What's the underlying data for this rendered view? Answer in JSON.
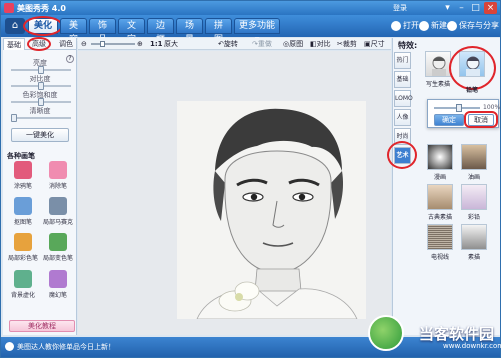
{
  "app": {
    "title": "美图秀秀 4.0",
    "login": "登录"
  },
  "menubar": {
    "tabs": [
      {
        "label": "美化",
        "active": true
      },
      {
        "label": "美容"
      },
      {
        "label": "饰品"
      },
      {
        "label": "文字"
      },
      {
        "label": "边框"
      },
      {
        "label": "场景"
      },
      {
        "label": "拼图"
      },
      {
        "label": "更多功能"
      }
    ],
    "open_label": "打开",
    "new_label": "新建",
    "save_label": "保存与分享"
  },
  "left_panel": {
    "subtabs": [
      "基础",
      "高级",
      "调色"
    ],
    "sliders": [
      {
        "label": "亮度",
        "value": 0.5
      },
      {
        "label": "对比度",
        "value": 0.5
      },
      {
        "label": "色彩饱和度",
        "value": 0.5
      },
      {
        "label": "清晰度",
        "value": 0.0
      }
    ],
    "auto_button": "一键美化",
    "brush_section": "各种画笔",
    "brushes": [
      {
        "label": "涂鸦笔",
        "color": "#e25b7c"
      },
      {
        "label": "消除笔",
        "color": "#f08cb0"
      },
      {
        "label": "抠图笔",
        "color": "#6a9ed8"
      },
      {
        "label": "局部马赛克",
        "color": "#7a8fa8"
      },
      {
        "label": "局部彩色笔",
        "color": "#e7a23d"
      },
      {
        "label": "局部变色笔",
        "color": "#59a85a"
      },
      {
        "label": "背景虚化",
        "color": "#5fb08d"
      },
      {
        "label": "魔幻笔",
        "color": "#b07ad0"
      }
    ],
    "beauty_button": "美化教程"
  },
  "toolbar": {
    "zoom_label": "1:1",
    "enlarge_label": "原大",
    "rotate_label": "旋转",
    "redo_label": "重做",
    "original_label": "原图",
    "compare_label": "对比",
    "crop_label": "裁剪",
    "size_label": "尺寸"
  },
  "right_panel": {
    "title": "特效:",
    "categories": [
      "热门",
      "基础",
      "LOMO",
      "人像",
      "时尚",
      "艺术"
    ],
    "active_category": "艺术",
    "popup": {
      "value": "100%",
      "confirm_label": "确定",
      "cancel_label": "取消",
      "level": 1.0
    },
    "effects": [
      {
        "label": "写生素描"
      },
      {
        "label": "铅笔"
      },
      {
        "label": "漫画"
      },
      {
        "label": "油画"
      },
      {
        "label": "古典素描"
      },
      {
        "label": "彩铅"
      },
      {
        "label": "电视线"
      },
      {
        "label": "素描"
      }
    ]
  },
  "status": {
    "message": "美图达人教你修单品今日上新！",
    "watermark": "当客软件园",
    "watermark_url": "www.downkr.com"
  },
  "colors": {
    "accent": "#2a74c2",
    "highlight": "#e0252b"
  }
}
